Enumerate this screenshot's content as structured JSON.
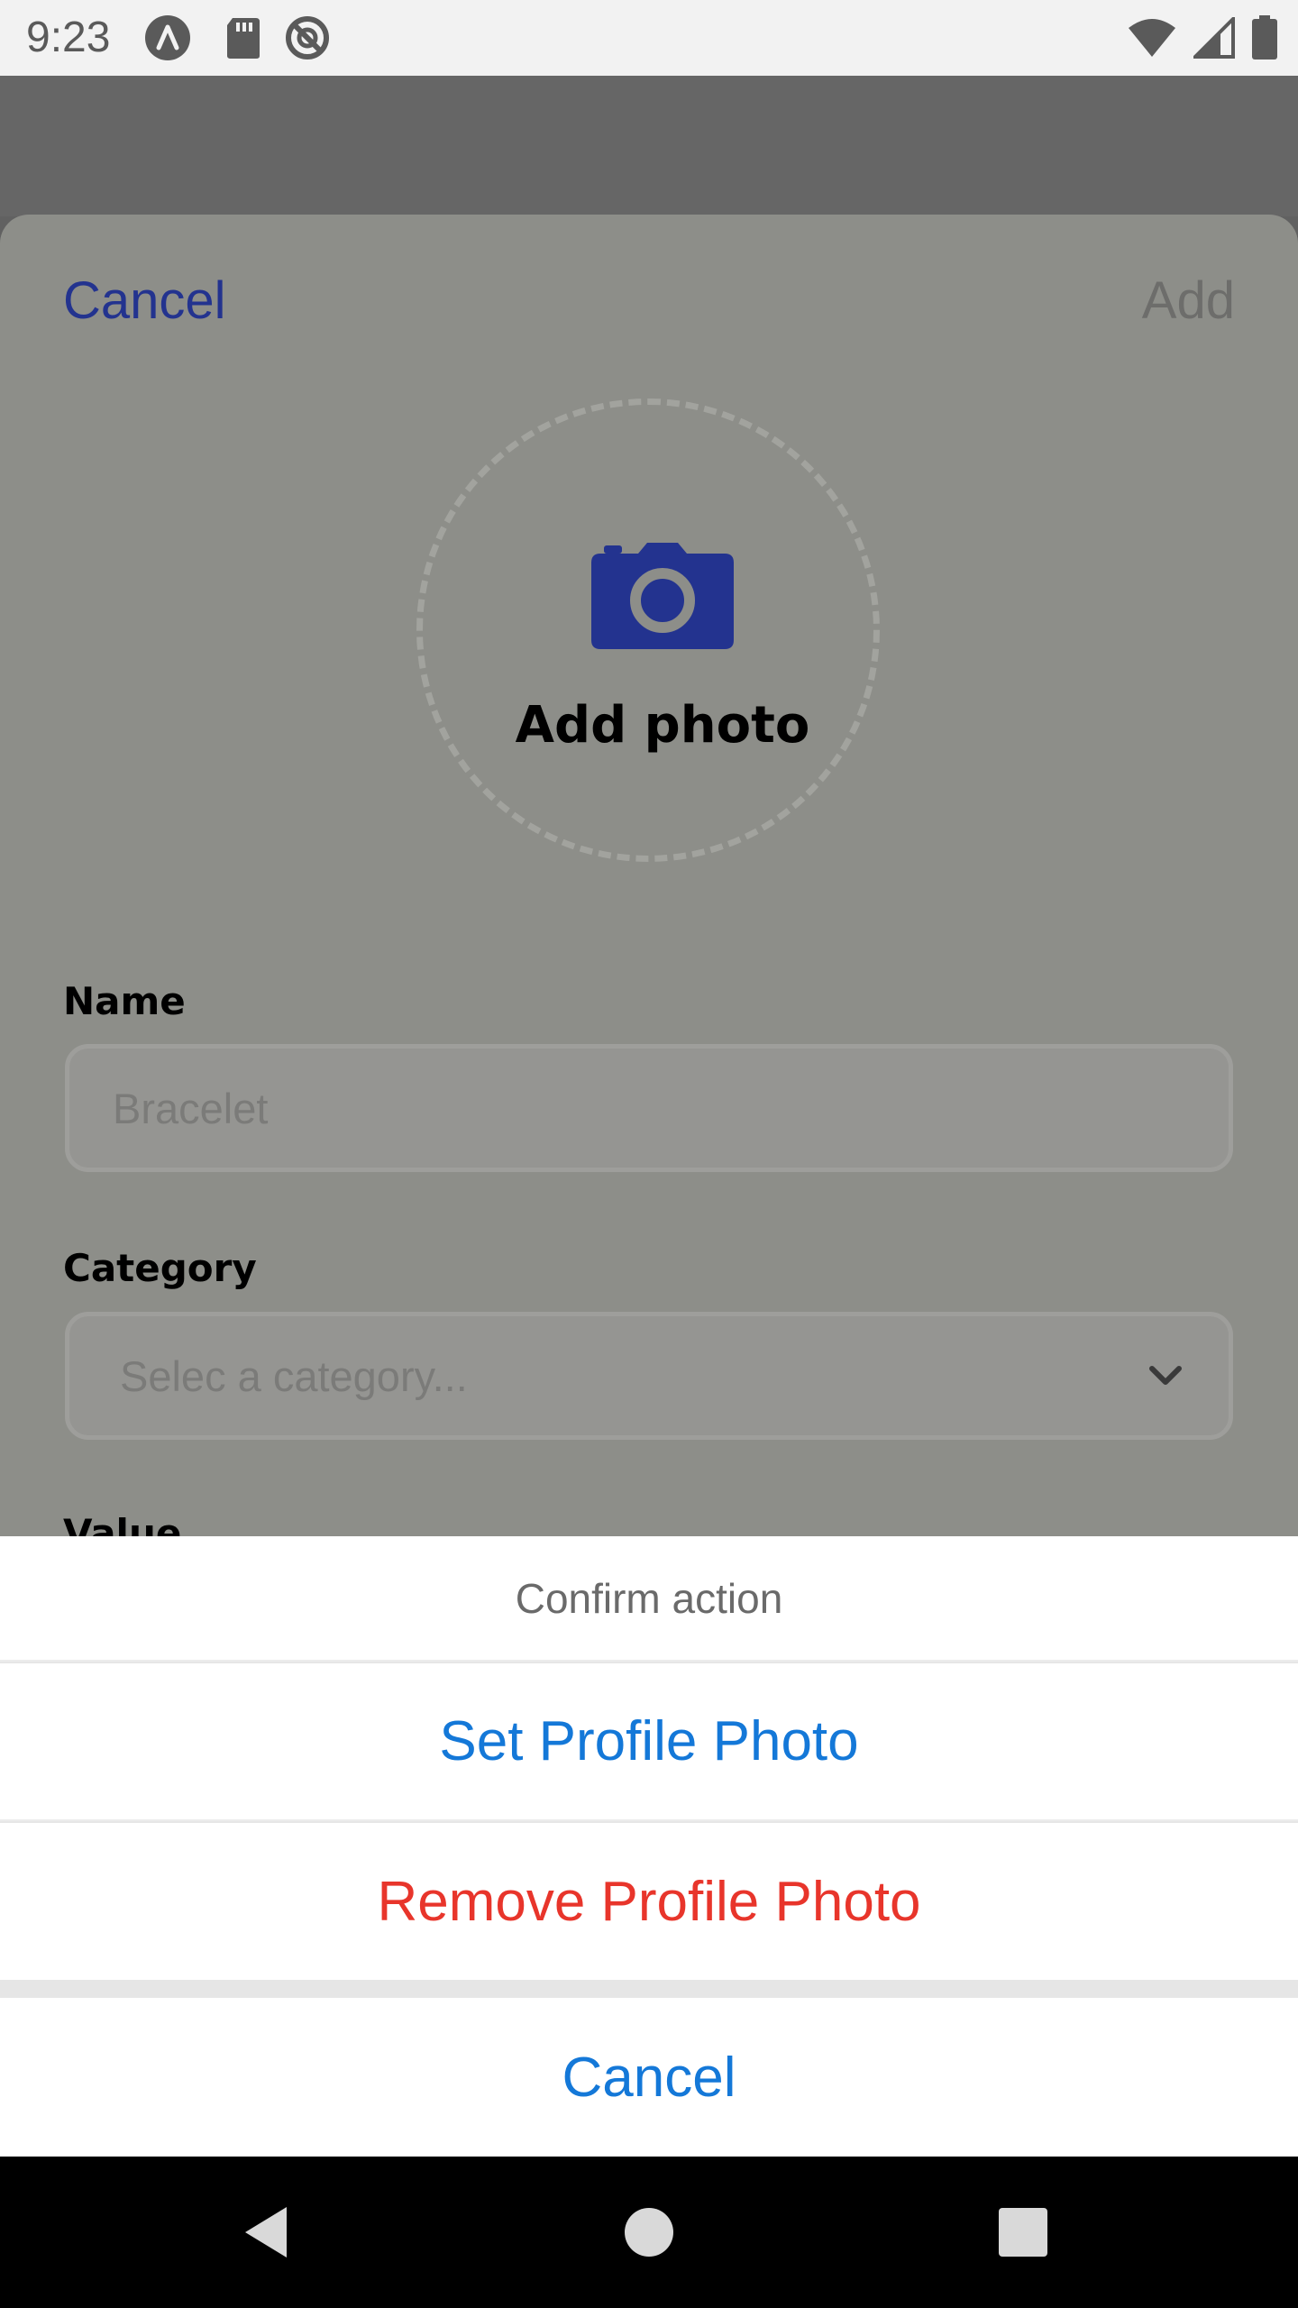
{
  "status_bar": {
    "time": "9:23",
    "left_icons": [
      "app-badge-icon",
      "sd-card-icon",
      "do-not-disturb-icon"
    ],
    "right_icons": [
      "wifi-icon",
      "cell-signal-icon",
      "battery-icon"
    ]
  },
  "header": {
    "cancel_label": "Cancel",
    "add_label": "Add"
  },
  "photo": {
    "icon": "camera-icon",
    "label": "Add photo"
  },
  "form": {
    "name_label": "Name",
    "name_placeholder": "Bracelet",
    "category_label": "Category",
    "category_placeholder": "Selec a category...",
    "value_label": "Value"
  },
  "action_sheet": {
    "title": "Confirm action",
    "set_label": "Set Profile Photo",
    "remove_label": "Remove Profile Photo",
    "cancel_label": "Cancel"
  },
  "colors": {
    "primary_blue": "#23338f",
    "ios_blue": "#1478d8",
    "destructive_red": "#e8352b"
  },
  "nav_bar": {
    "buttons": [
      "back-icon",
      "home-icon",
      "recents-icon"
    ]
  }
}
